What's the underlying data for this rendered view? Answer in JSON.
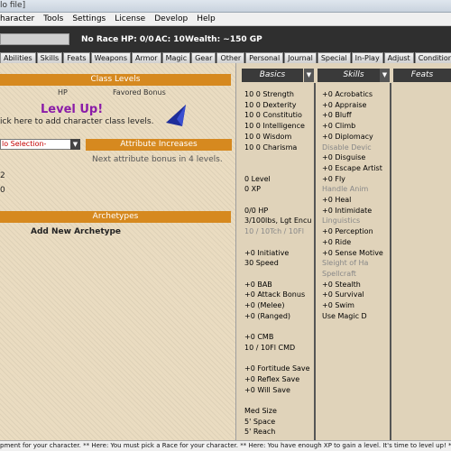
{
  "window": {
    "title": "lo file]"
  },
  "menu": [
    "haracter",
    "Tools",
    "Settings",
    "License",
    "Develop",
    "Help"
  ],
  "info": {
    "race": "No Race",
    "hp": "HP: 0/0",
    "ac": "AC: 10",
    "wealth": "Wealth: ~150 GP"
  },
  "tabs": [
    "Abilities",
    "Skills",
    "Feats",
    "Weapons",
    "Armor",
    "Magic",
    "Gear",
    "Other",
    "Personal",
    "Journal",
    "Special",
    "In-Play",
    "Adjust",
    "Condition"
  ],
  "left": {
    "class_levels_head": "Class Levels",
    "hp_col": "HP",
    "favored_col": "Favored Bonus",
    "level_up": "Level Up!",
    "add_class_hint": "ick here to add character class levels.",
    "no_selection": "lo Selection-",
    "attr_head": "Attribute Increases",
    "attr_hint": "Next attribute bonus in 4 levels.",
    "row1": "2",
    "row2": "0",
    "archetypes_head": "Archetypes",
    "add_archetype": "Add New Archetype"
  },
  "columns": {
    "basics": "Basics",
    "skills": "Skills",
    "feats": "Feats"
  },
  "basics_lines": [
    {
      "text": "10    0    Strength",
      "dim": false
    },
    {
      "text": "10    0    Dexterity",
      "dim": false
    },
    {
      "text": "10    0    Constitutio",
      "dim": false
    },
    {
      "text": "10    0    Intelligence",
      "dim": false
    },
    {
      "text": "10    0    Wisdom",
      "dim": false
    },
    {
      "text": "10    0    Charisma",
      "dim": false
    },
    {
      "text": "",
      "dim": false
    },
    {
      "text": "",
      "dim": false
    },
    {
      "text": "  0    Level",
      "dim": false
    },
    {
      "text": "  0    XP",
      "dim": false
    },
    {
      "text": "",
      "dim": false
    },
    {
      "text": "0/0 HP",
      "dim": false
    },
    {
      "text": "3/100lbs, Lgt Encu",
      "dim": false
    },
    {
      "text": " 10 / 10Tch / 10Fl",
      "dim": true
    },
    {
      "text": "",
      "dim": false
    },
    {
      "text": " +0    Initiative",
      "dim": false
    },
    {
      "text": " 30    Speed",
      "dim": false
    },
    {
      "text": "",
      "dim": false
    },
    {
      "text": " +0    BAB",
      "dim": false
    },
    {
      "text": " +0    Attack Bonus",
      "dim": false
    },
    {
      "text": " +0    (Melee)",
      "dim": false
    },
    {
      "text": " +0    (Ranged)",
      "dim": false
    },
    {
      "text": "",
      "dim": false
    },
    {
      "text": "  +0      CMB",
      "dim": false
    },
    {
      "text": " 10  / 10Fl    CMD",
      "dim": false
    },
    {
      "text": "",
      "dim": false
    },
    {
      "text": " +0    Fortitude Save",
      "dim": false
    },
    {
      "text": " +0    Reflex Save",
      "dim": false
    },
    {
      "text": " +0    Will Save",
      "dim": false
    },
    {
      "text": "",
      "dim": false
    },
    {
      "text": "Med Size",
      "dim": false
    },
    {
      "text": "  5'    Space",
      "dim": false
    },
    {
      "text": "  5'    Reach",
      "dim": false
    }
  ],
  "skills_lines": [
    {
      "text": "+0    Acrobatics",
      "dim": false
    },
    {
      "text": "+0    Appraise",
      "dim": false
    },
    {
      "text": "+0    Bluff",
      "dim": false
    },
    {
      "text": "+0    Climb",
      "dim": false
    },
    {
      "text": "+0    Diplomacy",
      "dim": false
    },
    {
      "text": "       Disable Devic",
      "dim": true
    },
    {
      "text": "+0    Disguise",
      "dim": false
    },
    {
      "text": "+0    Escape Artist",
      "dim": false
    },
    {
      "text": "+0    Fly",
      "dim": false
    },
    {
      "text": "       Handle Anim",
      "dim": true
    },
    {
      "text": "+0    Heal",
      "dim": false
    },
    {
      "text": "+0    Intimidate",
      "dim": false
    },
    {
      "text": "       Linguistics",
      "dim": true
    },
    {
      "text": "+0    Perception",
      "dim": false
    },
    {
      "text": "+0    Ride",
      "dim": false
    },
    {
      "text": "+0    Sense Motive",
      "dim": false
    },
    {
      "text": "       Sleight of Ha",
      "dim": true
    },
    {
      "text": "       Spellcraft",
      "dim": true
    },
    {
      "text": "+0    Stealth",
      "dim": false
    },
    {
      "text": "+0    Survival",
      "dim": false
    },
    {
      "text": "+0    Swim",
      "dim": false
    },
    {
      "text": "       Use Magic D",
      "dim": false
    }
  ],
  "statusbar": "pment for your character.  ** Here: You must pick a Race for your character.  ** Here: You have enough XP to gain a level. It's time to level up! ** Wealth"
}
